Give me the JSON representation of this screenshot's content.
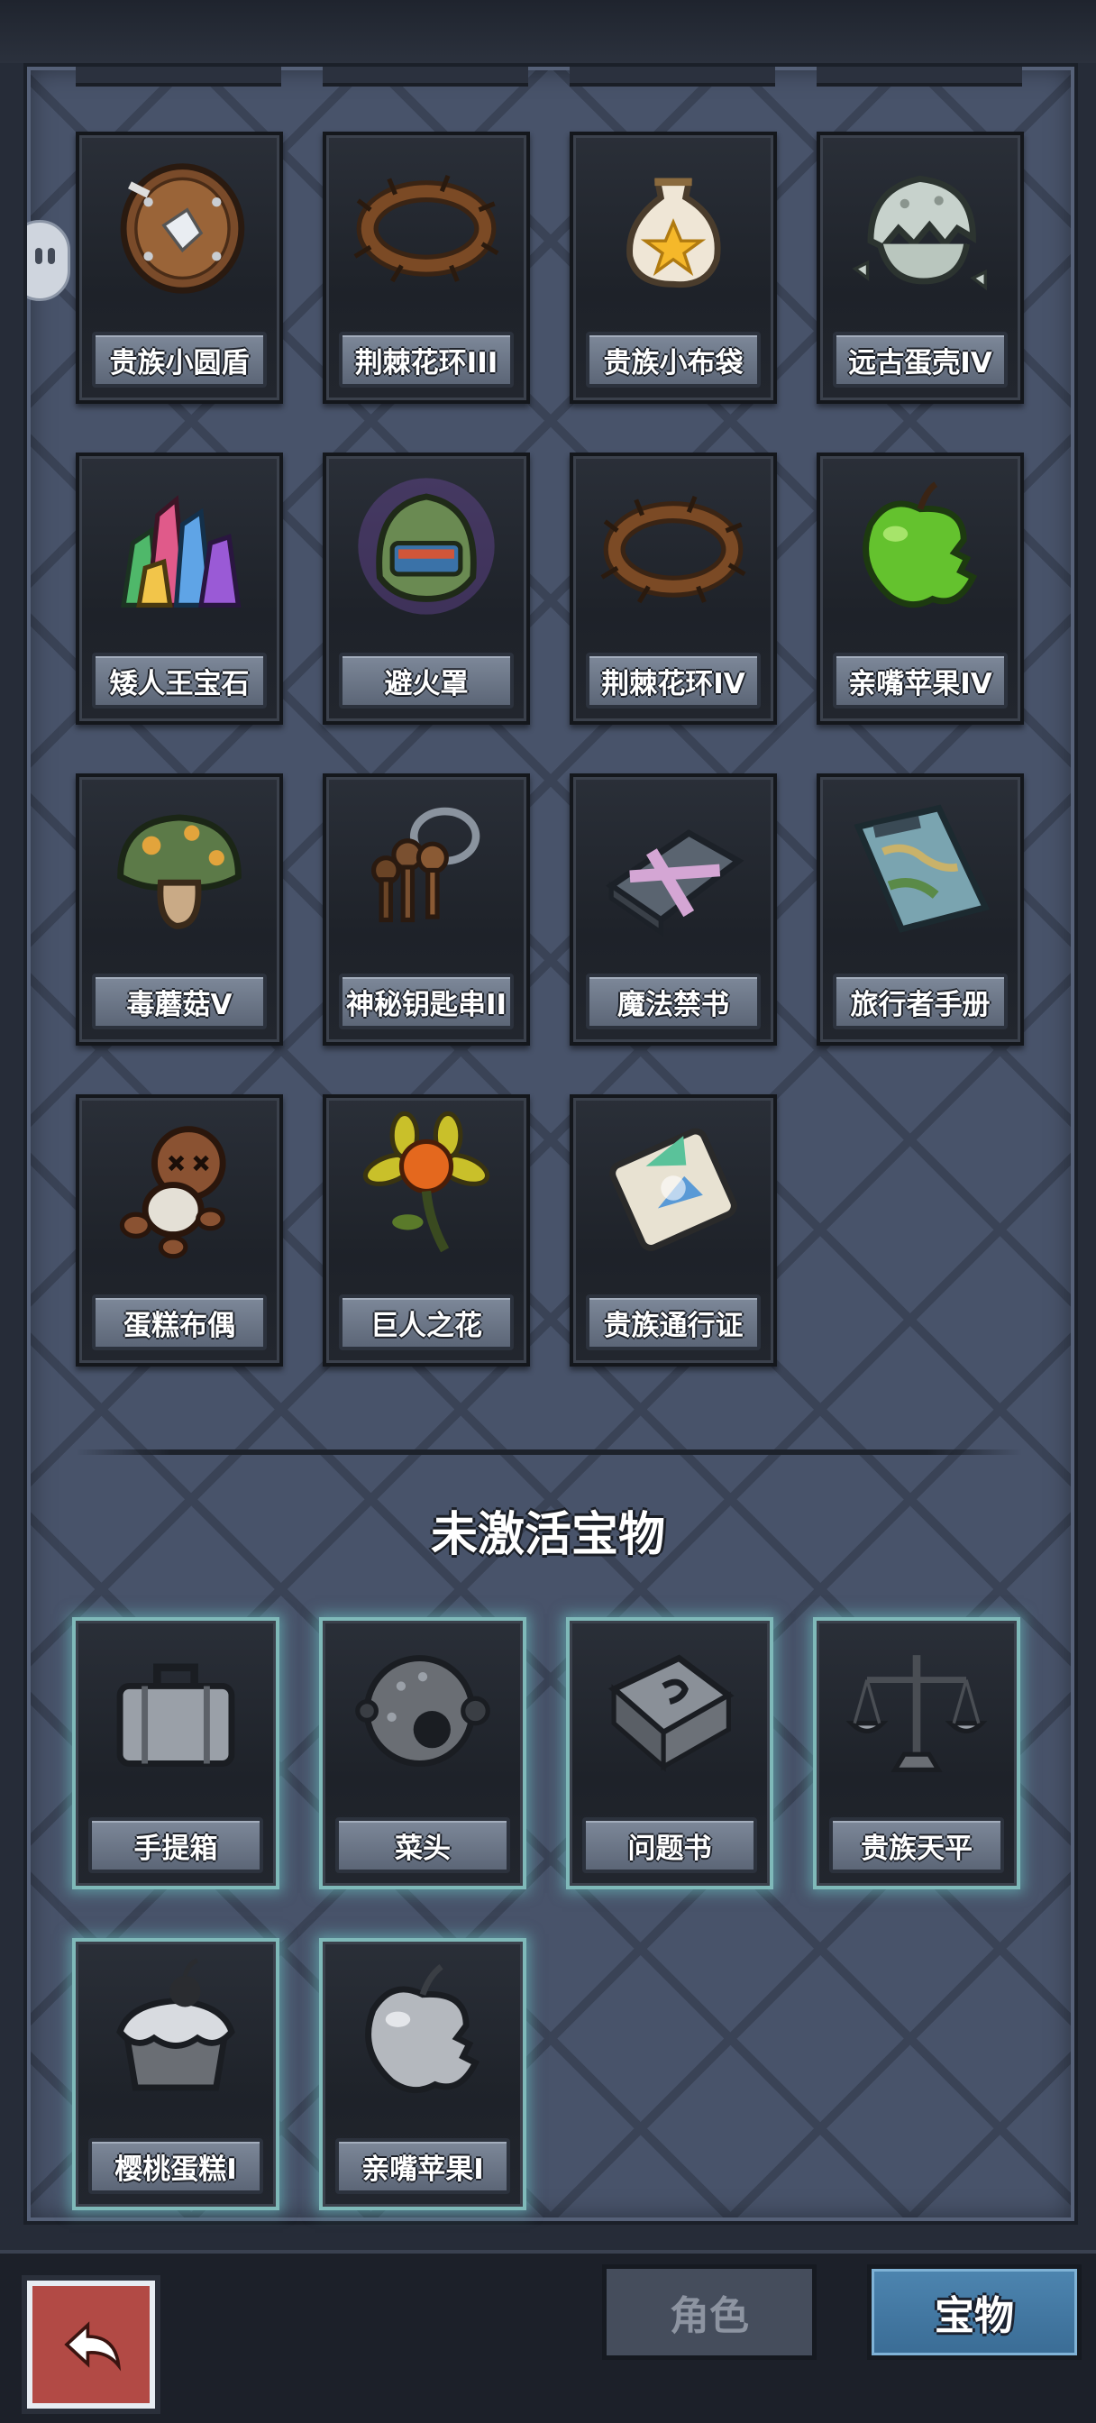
{
  "colors": {
    "panel_bg": "#48536a",
    "card_bg": "#1e2229",
    "label_plate": "#6a7586",
    "inactive_glow": "#6ec8c8",
    "back_button": "#b24a45",
    "active_tab": "#4d85b0"
  },
  "active_items": [
    {
      "name": "贵族小圆盾",
      "icon": "wooden-shield-icon"
    },
    {
      "name": "荆棘花环III",
      "icon": "thorn-wreath-icon"
    },
    {
      "name": "贵族小布袋",
      "icon": "cloth-pouch-icon"
    },
    {
      "name": "远古蛋壳IV",
      "icon": "broken-eggshell-icon"
    },
    {
      "name": "矮人王宝石",
      "icon": "gem-cluster-icon"
    },
    {
      "name": "避火罩",
      "icon": "fire-mask-helmet-icon"
    },
    {
      "name": "荆棘花环IV",
      "icon": "thorn-wreath-icon"
    },
    {
      "name": "亲嘴苹果IV",
      "icon": "bitten-green-apple-icon"
    },
    {
      "name": "毒蘑菇V",
      "icon": "poison-mushroom-icon"
    },
    {
      "name": "神秘钥匙串II",
      "icon": "key-ring-icon"
    },
    {
      "name": "魔法禁书",
      "icon": "sealed-book-icon"
    },
    {
      "name": "旅行者手册",
      "icon": "travel-map-icon"
    },
    {
      "name": "蛋糕布偶",
      "icon": "voodoo-doll-icon"
    },
    {
      "name": "巨人之花",
      "icon": "giant-flower-icon"
    },
    {
      "name": "贵族通行证",
      "icon": "noble-pass-card-icon"
    }
  ],
  "inactive_section": {
    "title": "未激活宝物"
  },
  "inactive_items": [
    {
      "name": "手提箱",
      "icon": "suitcase-icon"
    },
    {
      "name": "菜头",
      "icon": "spiked-head-icon"
    },
    {
      "name": "问题书",
      "icon": "question-book-icon"
    },
    {
      "name": "贵族天平",
      "icon": "balance-scale-icon"
    },
    {
      "name": "樱桃蛋糕I",
      "icon": "cherry-cake-icon"
    },
    {
      "name": "亲嘴苹果I",
      "icon": "bitten-apple-icon"
    }
  ],
  "bottom_bar": {
    "back_icon": "return-arrow-icon",
    "tabs": [
      {
        "label": "角色",
        "active": false
      },
      {
        "label": "宝物",
        "active": true
      }
    ]
  }
}
